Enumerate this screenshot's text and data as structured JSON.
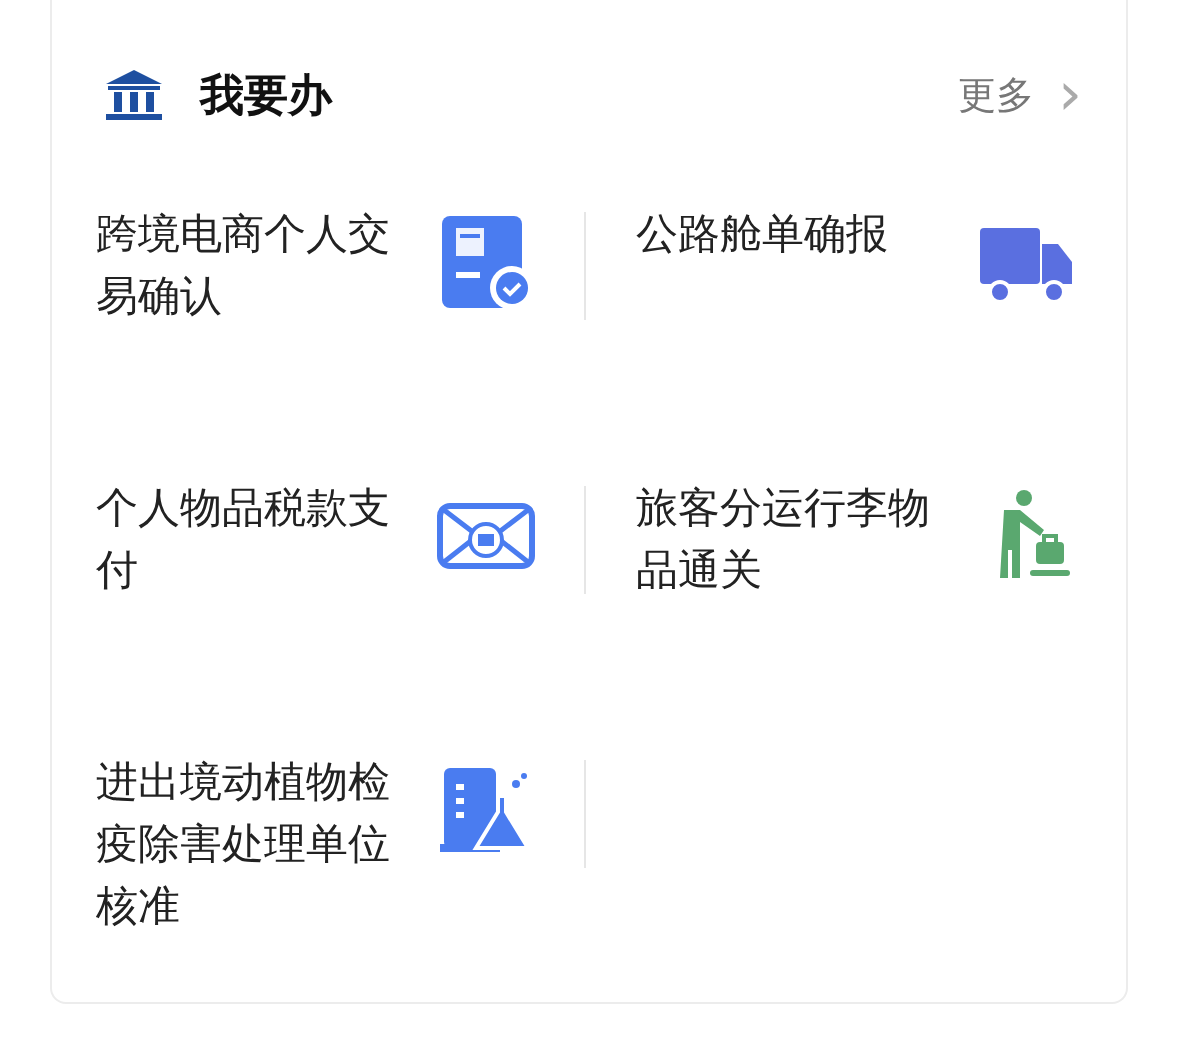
{
  "section": {
    "title": "我要办",
    "more": "更多",
    "more_arrow": "›"
  },
  "items": [
    {
      "label": "跨境电商个人交易确认",
      "kind": "card-check"
    },
    {
      "label": "公路舱单确报",
      "kind": "truck"
    },
    {
      "label": "个人物品税款支付",
      "kind": "envelope"
    },
    {
      "label": "旅客分运行李物品通关",
      "kind": "porter"
    },
    {
      "label": "进出境动植物检疫除害处理单位核准",
      "kind": "lab"
    }
  ]
}
